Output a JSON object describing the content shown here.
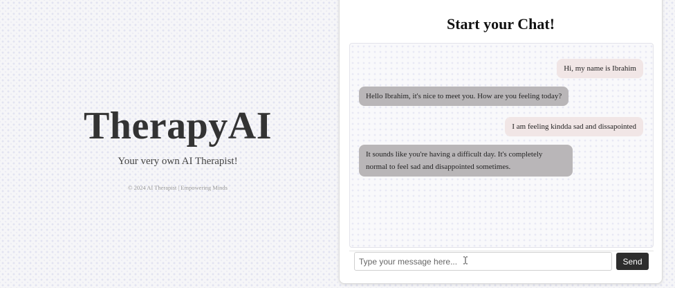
{
  "hero": {
    "brand": "TherapyAI",
    "tagline": "Your very own AI Therapist!",
    "footer": "© 2024 AI Therapist | Empowering Minds"
  },
  "chat": {
    "title": "Start your Chat!",
    "messages": [
      {
        "sender": "user",
        "text": "Hi, my name is Ibrahim"
      },
      {
        "sender": "ai",
        "text": "Hello Ibrahim, it's nice to meet you. How are you feeling today?"
      },
      {
        "sender": "user",
        "text": "I am feeling kindda sad and dissapointed"
      },
      {
        "sender": "ai",
        "text": "It sounds like you're having a difficult day. It's completely normal to feel sad and disappointed sometimes."
      }
    ],
    "input": {
      "placeholder": "Type your message here...",
      "value": ""
    },
    "send_label": "Send"
  },
  "colors": {
    "user_bubble": "#f1e6e6",
    "ai_bubble": "#b9b6b8",
    "send_button": "#2d2d2d"
  },
  "icons": {
    "text_cursor": "i-beam-cursor-icon"
  }
}
